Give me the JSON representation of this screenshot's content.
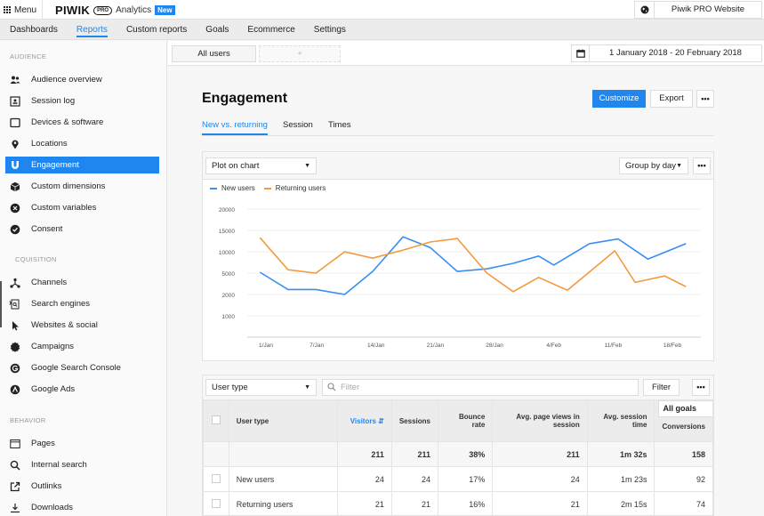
{
  "topbar": {
    "menu_label": "Menu",
    "logo_word": "PIWIK",
    "logo_pro": "PRO",
    "app_name": "Analytics",
    "new_badge": "New",
    "website": "Piwik PRO Website",
    "website_icon": "globe-icon"
  },
  "nav": {
    "items": [
      {
        "label": "Dashboards",
        "active": false
      },
      {
        "label": "Reports",
        "active": true
      },
      {
        "label": "Custom reports",
        "active": false
      },
      {
        "label": "Goals",
        "active": false
      },
      {
        "label": "Ecommerce",
        "active": false
      },
      {
        "label": "Settings",
        "active": false
      }
    ]
  },
  "sidebar": {
    "sections": [
      {
        "title": "AUDIENCE",
        "items": [
          {
            "label": "Audience overview",
            "icon": "users-icon"
          },
          {
            "label": "Session log",
            "icon": "session-log-icon"
          },
          {
            "label": "Devices & software",
            "icon": "tablet-icon"
          },
          {
            "label": "Locations",
            "icon": "location-pin-icon"
          },
          {
            "label": "Engagement",
            "icon": "magnet-icon",
            "active": true
          },
          {
            "label": "Custom dimensions",
            "icon": "cube-icon"
          },
          {
            "label": "Custom variables",
            "icon": "variable-icon"
          },
          {
            "label": "Consent",
            "icon": "check-circle-icon"
          }
        ]
      },
      {
        "title": "ACQUISITION",
        "items": [
          {
            "label": "Channels",
            "icon": "channels-icon"
          },
          {
            "label": "Search engines",
            "icon": "search-engine-icon"
          },
          {
            "label": "Websites & social",
            "icon": "cursor-icon"
          },
          {
            "label": "Campaigns",
            "icon": "badge-icon"
          },
          {
            "label": "Google Search Console",
            "icon": "google-icon"
          },
          {
            "label": "Google Ads",
            "icon": "google-ads-icon"
          }
        ]
      },
      {
        "title": "BEHAVIOR",
        "items": [
          {
            "label": "Pages",
            "icon": "window-icon"
          },
          {
            "label": "Internal search",
            "icon": "search-icon"
          },
          {
            "label": "Outlinks",
            "icon": "external-link-icon"
          },
          {
            "label": "Downloads",
            "icon": "download-icon"
          }
        ]
      }
    ]
  },
  "segments": {
    "current": "All users",
    "add_label": "+"
  },
  "date_range": "1 January 2018 - 20 February 2018",
  "page": {
    "title": "Engagement",
    "customize_label": "Customize",
    "export_label": "Export",
    "more_label": "•••",
    "tabs": [
      {
        "label": "New vs. returning",
        "active": true
      },
      {
        "label": "Session",
        "active": false
      },
      {
        "label": "Times",
        "active": false
      }
    ]
  },
  "chart_card": {
    "plot_select": "Plot on chart",
    "group_select": "Group by day",
    "more_label": "•••"
  },
  "colors": {
    "accent": "#1f86f0",
    "new_users": "#3b8ef0",
    "returning_users": "#f39a3c"
  },
  "chart_data": {
    "type": "line",
    "title": "",
    "xlabel": "",
    "ylabel": "",
    "x_ticks": [
      {
        "day": 0,
        "label": "1/Jan"
      },
      {
        "day": 6,
        "label": "7/Jan"
      },
      {
        "day": 13,
        "label": "14/Jan"
      },
      {
        "day": 20,
        "label": "21/Jan"
      },
      {
        "day": 27,
        "label": "28/Jan"
      },
      {
        "day": 34,
        "label": "4/Feb"
      },
      {
        "day": 41,
        "label": "11/Feb"
      },
      {
        "day": 48,
        "label": "18/Feb"
      }
    ],
    "y_ticks": [
      0,
      1000,
      2000,
      5000,
      10000,
      15000,
      20000
    ],
    "y_tick_labels": [
      "",
      "1000",
      "2000",
      "5000",
      "10000",
      "15000",
      "20000"
    ],
    "ylim": [
      0,
      20000
    ],
    "grid": true,
    "legend": "top-left",
    "series": [
      {
        "name": "New users",
        "x": [
          -0.7,
          2.6,
          5.9,
          9.3,
          12.6,
          16.2,
          19.4,
          22.6,
          26.1,
          29.2,
          32.2,
          34.0,
          38.2,
          41.6,
          45.1,
          49.6
        ],
        "values": [
          5200,
          2700,
          2700,
          2000,
          5400,
          13500,
          11000,
          5400,
          6000,
          7300,
          9000,
          6900,
          11900,
          13000,
          8300,
          11900
        ]
      },
      {
        "name": "Returning users",
        "x": [
          -0.7,
          2.6,
          5.9,
          9.3,
          12.6,
          16.2,
          19.4,
          22.6,
          26.1,
          29.2,
          32.2,
          35.6,
          41.2,
          43.6,
          47.1,
          49.6
        ],
        "values": [
          13300,
          5800,
          5000,
          10000,
          8500,
          10400,
          12300,
          13100,
          5000,
          2400,
          4400,
          2600,
          10200,
          3700,
          4600,
          3100
        ]
      }
    ]
  },
  "table": {
    "dimension_select": "User type",
    "filter_placeholder": "Filter",
    "filter_button": "Filter",
    "more_label": "•••",
    "goals_select": "All goals",
    "columns": [
      "User type",
      "Visitors",
      "Sessions",
      "Bounce rate",
      "Avg. page views in session",
      "Avg. session time",
      "Conversions"
    ],
    "sorted_column": "Visitors",
    "totals": [
      "",
      "211",
      "211",
      "38%",
      "211",
      "1m 32s",
      "158"
    ],
    "rows": [
      [
        "New users",
        "24",
        "24",
        "17%",
        "24",
        "1m 23s",
        "92"
      ],
      [
        "Returning users",
        "21",
        "21",
        "16%",
        "21",
        "2m 15s",
        "74"
      ]
    ]
  }
}
